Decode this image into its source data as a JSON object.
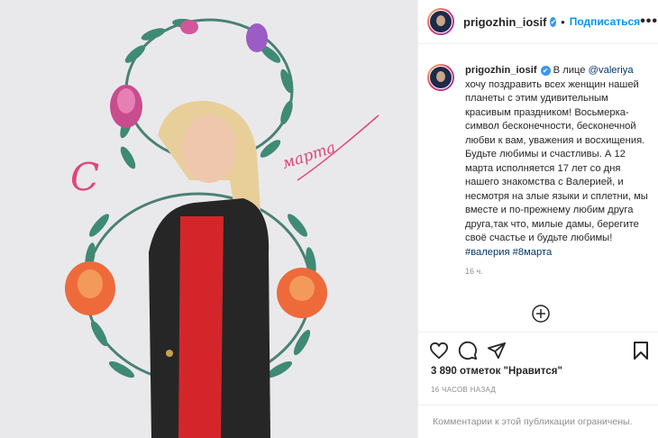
{
  "post": {
    "username": "prigozhin_iosif",
    "follow_label": "Подписаться",
    "dot": "•",
    "more": "•••",
    "caption": {
      "username": "prigozhin_iosif",
      "text_before_mention": " В лице ",
      "mention": "@valeriya",
      "text_body": " хочу поздравить всех женщин нашей планеты с этим удивительным красивым праздником! Восьмерка- символ бесконечности, бесконечной любви к вам, уважения и восхищения. Будьте любимы и счастливы. А 12 марта исполняется 17 лет со дня нашего знакомства с Валерией, и несмотря на злые языки и сплетни, мы вместе и по-прежнему любим друга друга,так что, милые дамы, берегите своё счастье и будьте любимы!",
      "hashtag1": "#валерия",
      "hashtag2": "#8марта"
    },
    "caption_time": "16 ч.",
    "likes": "3 890 отметок \"Нравится\"",
    "posted_ago": "16 ЧАСОВ НАЗАД",
    "comments_closed": "Комментарии к этой публикации ограничены."
  },
  "photo": {
    "script_c": "С",
    "script_marta": "марта"
  },
  "icons": {
    "verified": "check",
    "like": "heart-icon",
    "comment": "comment-icon",
    "share": "share-icon",
    "save": "bookmark-icon",
    "load_more": "plus-circle-icon"
  },
  "colors": {
    "accent": "#0095f6",
    "link": "#00376b",
    "muted": "#8e8e8e",
    "photo_bg": "#e9e9ec",
    "script_pink": "#e0457b"
  }
}
